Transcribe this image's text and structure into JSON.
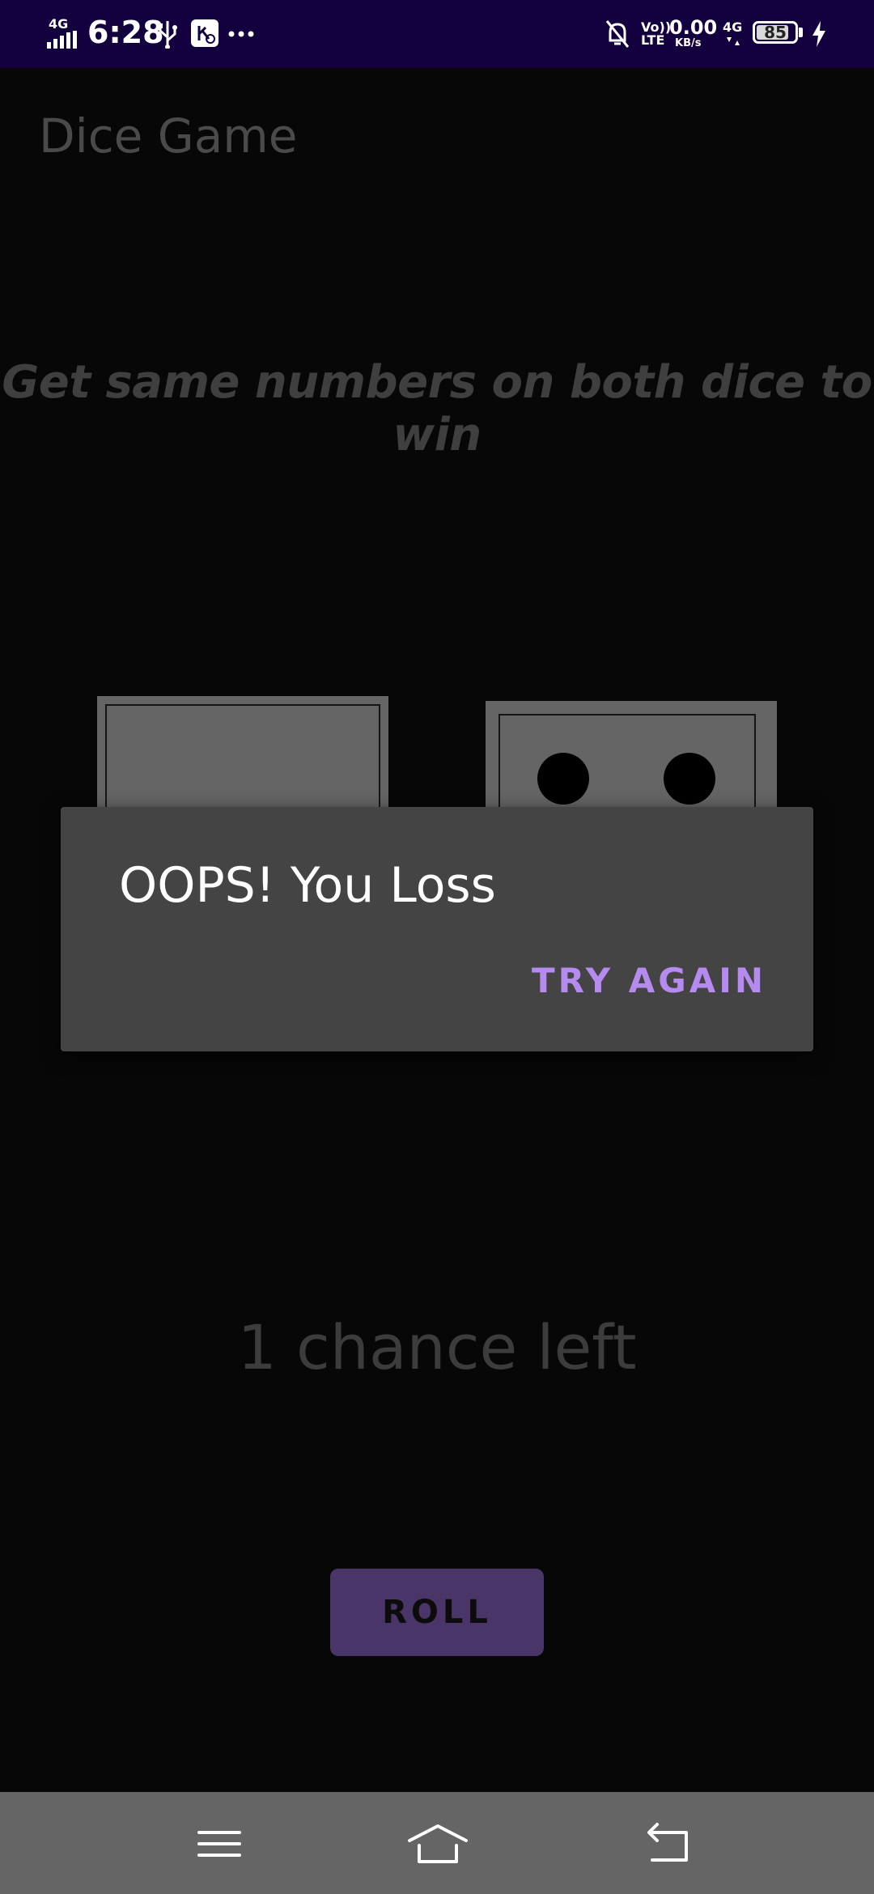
{
  "status_bar": {
    "network_left": "4G",
    "time": "6:28",
    "volte": "Vo))",
    "lte": "LTE",
    "speed_value": "0.00",
    "speed_unit": "KB/s",
    "network_right": "4G",
    "battery": "85",
    "battery_level": 0.85,
    "icons": [
      "signal-icon",
      "usb-icon",
      "app-notification-icon",
      "more-icon",
      "mute-icon",
      "data-arrows-icon",
      "battery-icon",
      "charging-icon"
    ]
  },
  "app": {
    "title": "Dice Game",
    "instructions": "Get same numbers on both dice to win",
    "chances": "1 chance left",
    "roll_label": "ROLL",
    "dice": [
      {
        "name": "die-left",
        "pips_visible": 0
      },
      {
        "name": "die-right",
        "pips_visible": 2
      }
    ]
  },
  "dialog": {
    "title": "OOPS! You Loss",
    "button_label": "TRY AGAIN"
  },
  "nav_bar": {
    "buttons": [
      "menu-icon",
      "home-icon",
      "back-icon"
    ]
  },
  "colors": {
    "status_bar_bg": "#12003f",
    "background": "#070707",
    "dialog_bg": "#444444",
    "accent": "#b68bf0",
    "roll_button_bg": "#4a3569",
    "nav_bar_bg": "#656565"
  }
}
